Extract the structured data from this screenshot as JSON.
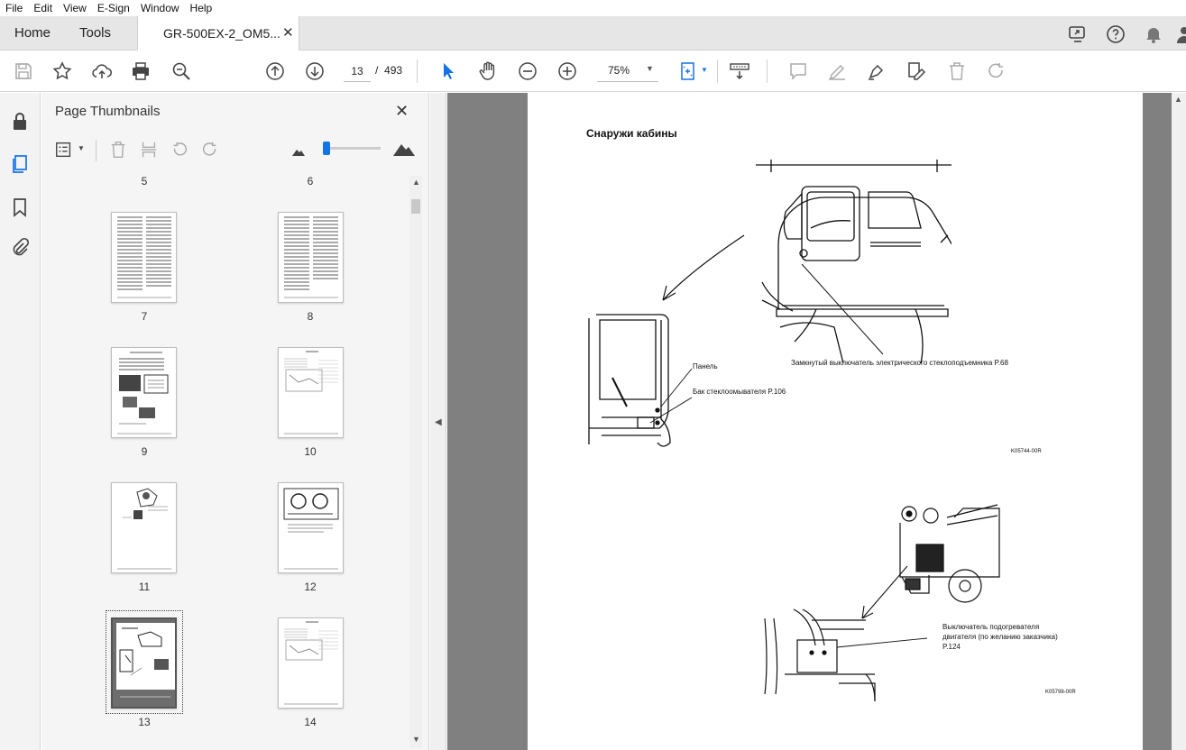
{
  "menu": [
    "File",
    "Edit",
    "View",
    "E-Sign",
    "Window",
    "Help"
  ],
  "tabs": {
    "home": "Home",
    "tools": "Tools",
    "document": "GR-500EX-2_OM5...",
    "close": "✕"
  },
  "toolbar": {
    "current_page": "13",
    "separator": "/",
    "total_pages": "493",
    "zoom": "75%"
  },
  "panel": {
    "title": "Page Thumbnails",
    "close": "✕",
    "thumbnails": [
      {
        "label": "5"
      },
      {
        "label": "6"
      },
      {
        "label": "7"
      },
      {
        "label": "8"
      },
      {
        "label": "9"
      },
      {
        "label": "10"
      },
      {
        "label": "11"
      },
      {
        "label": "12"
      },
      {
        "label": "13",
        "selected": true
      },
      {
        "label": "14"
      }
    ]
  },
  "document": {
    "heading": "Снаружи кабины",
    "labels": {
      "switch": "Замкнутый выключатель электрического стеклоподъемника P.68",
      "panel": "Панель",
      "tank": "Бак стеклоомывателя P.106",
      "code1": "K05744-00R",
      "heater1": "Выключатель подогревателя",
      "heater2": "двигателя (по желанию заказчика)",
      "heater3": "P.124",
      "code2": "K05798-00R"
    }
  },
  "colors": {
    "accent": "#1473e6",
    "doc_bg": "#808080",
    "chrome": "#e6e6e6"
  }
}
